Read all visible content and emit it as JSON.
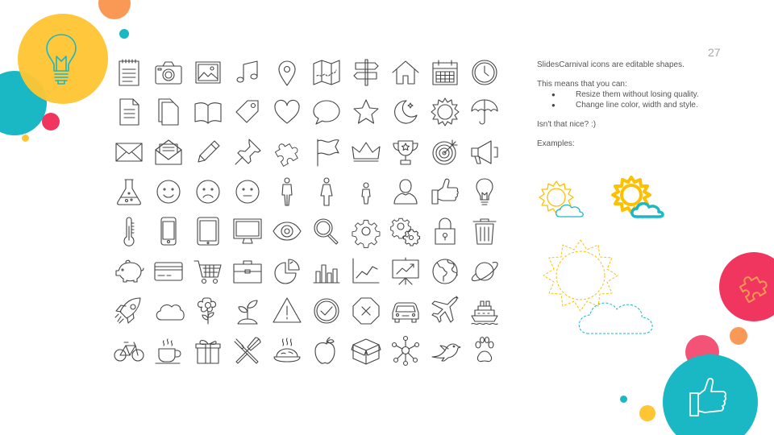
{
  "slide": {
    "page_number": "27",
    "intro": "SlidesCarnival icons are editable shapes.",
    "means": "This means that you can:",
    "bullets": [
      "Resize them without losing quality.",
      "Change line color, width and style."
    ],
    "question": "Isn't that nice? :)",
    "examples_label": "Examples:"
  },
  "colors": {
    "yellow": "#FFC532",
    "teal": "#1AB7C4",
    "pink": "#F0355E",
    "orange": "#FA9855",
    "icon_stroke": "#444444",
    "sun_yellow": "#FFC000",
    "cloud_teal": "#1AB7C4"
  },
  "icons": [
    [
      "notepad-icon",
      "camera-icon",
      "picture-icon",
      "music-note-icon",
      "map-pin-icon",
      "map-icon",
      "signpost-icon",
      "home-icon",
      "calendar-icon",
      "clock-icon"
    ],
    [
      "document-icon",
      "files-icon",
      "open-book-icon",
      "tag-icon",
      "heart-icon",
      "speech-bubble-icon",
      "star-icon",
      "moon-icon",
      "sun-icon",
      "umbrella-icon"
    ],
    [
      "envelope-icon",
      "open-envelope-icon",
      "pencil-icon",
      "pushpin-icon",
      "puzzle-icon",
      "flag-icon",
      "crown-icon",
      "trophy-icon",
      "target-icon",
      "megaphone-icon"
    ],
    [
      "flask-icon",
      "smile-icon",
      "sad-face-icon",
      "neutral-face-icon",
      "man-icon",
      "woman-icon",
      "child-icon",
      "user-icon",
      "thumbs-up-icon",
      "lightbulb-icon"
    ],
    [
      "thermometer-icon",
      "smartphone-icon",
      "tablet-icon",
      "monitor-icon",
      "eye-icon",
      "magnifier-icon",
      "gear-icon",
      "gears-icon",
      "padlock-icon",
      "trash-icon"
    ],
    [
      "piggy-bank-icon",
      "credit-card-icon",
      "shopping-cart-icon",
      "briefcase-icon",
      "pie-chart-icon",
      "bar-chart-icon",
      "line-chart-icon",
      "presentation-icon",
      "globe-icon",
      "planet-icon"
    ],
    [
      "rocket-icon",
      "cloud-icon",
      "flower-icon",
      "sprout-icon",
      "warning-icon",
      "check-icon",
      "cancel-icon",
      "car-icon",
      "airplane-icon",
      "ship-icon"
    ],
    [
      "bicycle-icon",
      "coffee-cup-icon",
      "gift-icon",
      "fork-knife-icon",
      "food-dish-icon",
      "apple-icon",
      "box-icon",
      "network-icon",
      "bird-icon",
      "paw-icon"
    ]
  ]
}
